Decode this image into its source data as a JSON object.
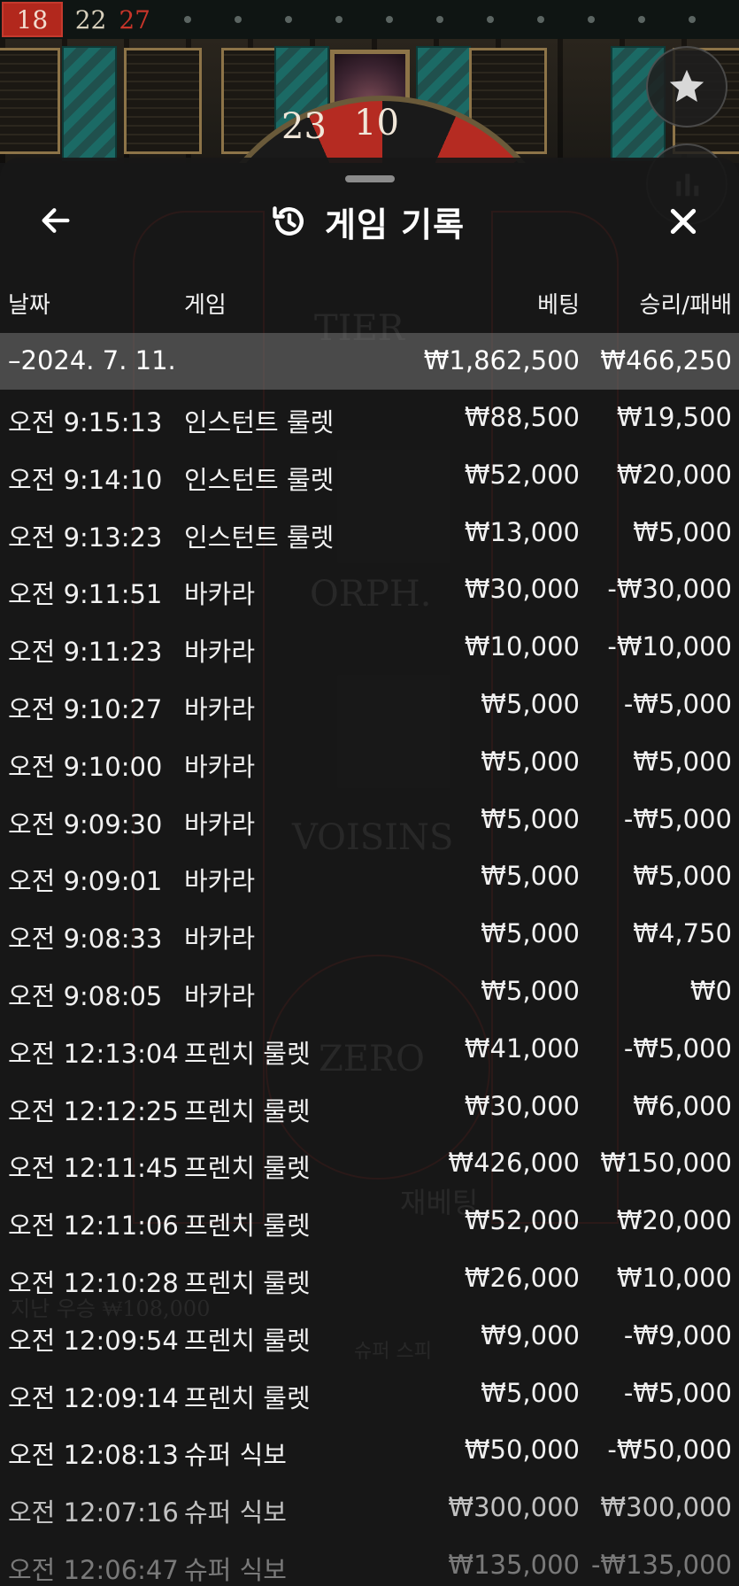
{
  "results_strip": {
    "latest": "18",
    "items": [
      {
        "number": "22",
        "color": "black"
      },
      {
        "number": "27",
        "color": "red"
      }
    ],
    "empty_slots": 12
  },
  "background": {
    "wheel_numbers": [
      "23",
      "10"
    ]
  },
  "modal": {
    "title": "게임 기록",
    "icons": {
      "back": "back-arrow-icon",
      "history": "history-icon",
      "close": "close-icon"
    },
    "columns": {
      "date": "날짜",
      "game": "게임",
      "bet": "베팅",
      "win_loss": "승리/패배"
    },
    "day_group": {
      "label": "–2024. 7. 11.",
      "bet_total": "₩1,862,500",
      "win_total": "₩466,250"
    },
    "rows": [
      {
        "time": "오전 9:15:13",
        "game": "인스턴트 룰렛",
        "bet": "₩88,500",
        "result": "₩19,500"
      },
      {
        "time": "오전 9:14:10",
        "game": "인스턴트 룰렛",
        "bet": "₩52,000",
        "result": "₩20,000"
      },
      {
        "time": "오전 9:13:23",
        "game": "인스턴트 룰렛",
        "bet": "₩13,000",
        "result": "₩5,000"
      },
      {
        "time": "오전 9:11:51",
        "game": "바카라",
        "bet": "₩30,000",
        "result": "-₩30,000"
      },
      {
        "time": "오전 9:11:23",
        "game": "바카라",
        "bet": "₩10,000",
        "result": "-₩10,000"
      },
      {
        "time": "오전 9:10:27",
        "game": "바카라",
        "bet": "₩5,000",
        "result": "-₩5,000"
      },
      {
        "time": "오전 9:10:00",
        "game": "바카라",
        "bet": "₩5,000",
        "result": "₩5,000"
      },
      {
        "time": "오전 9:09:30",
        "game": "바카라",
        "bet": "₩5,000",
        "result": "-₩5,000"
      },
      {
        "time": "오전 9:09:01",
        "game": "바카라",
        "bet": "₩5,000",
        "result": "₩5,000"
      },
      {
        "time": "오전 9:08:33",
        "game": "바카라",
        "bet": "₩5,000",
        "result": "₩4,750"
      },
      {
        "time": "오전 9:08:05",
        "game": "바카라",
        "bet": "₩5,000",
        "result": "₩0"
      },
      {
        "time": "오전 12:13:04",
        "game": "프렌치 룰렛",
        "bet": "₩41,000",
        "result": "-₩5,000"
      },
      {
        "time": "오전 12:12:25",
        "game": "프렌치 룰렛",
        "bet": "₩30,000",
        "result": "₩6,000"
      },
      {
        "time": "오전 12:11:45",
        "game": "프렌치 룰렛",
        "bet": "₩426,000",
        "result": "₩150,000"
      },
      {
        "time": "오전 12:11:06",
        "game": "프렌치 룰렛",
        "bet": "₩52,000",
        "result": "₩20,000"
      },
      {
        "time": "오전 12:10:28",
        "game": "프렌치 룰렛",
        "bet": "₩26,000",
        "result": "₩10,000"
      },
      {
        "time": "오전 12:09:54",
        "game": "프렌치 룰렛",
        "bet": "₩9,000",
        "result": "-₩9,000"
      },
      {
        "time": "오전 12:09:14",
        "game": "프렌치 룰렛",
        "bet": "₩5,000",
        "result": "-₩5,000"
      },
      {
        "time": "오전 12:08:13",
        "game": "슈퍼 식보",
        "bet": "₩50,000",
        "result": "-₩50,000"
      },
      {
        "time": "오전 12:07:16",
        "game": "슈퍼 식보",
        "bet": "₩300,000",
        "result": "₩300,000"
      },
      {
        "time": "오전 12:06:47",
        "game": "슈퍼 식보",
        "bet": "₩135,000",
        "result": "-₩135,000"
      }
    ]
  },
  "background_table_text": [
    "TIER",
    "ORPH.",
    "VOISINS",
    "ZERO",
    "재베팅",
    "지난 우승 ₩108,000",
    "슈퍼 스피"
  ]
}
